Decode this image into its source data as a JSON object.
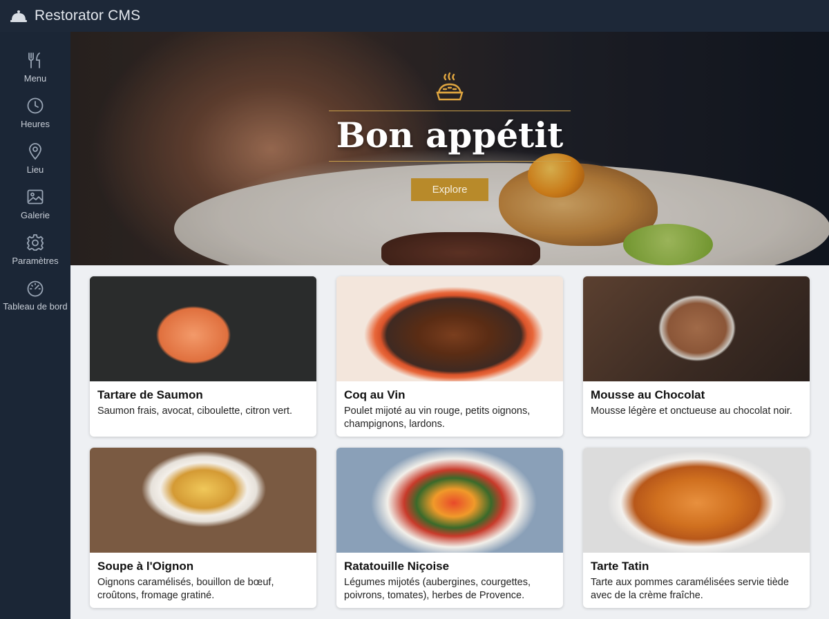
{
  "app": {
    "title": "Restorator CMS",
    "logo_icon": "cloche-icon"
  },
  "sidebar": {
    "items": [
      {
        "label": "Menu",
        "icon": "fork-knife-icon"
      },
      {
        "label": "Heures",
        "icon": "clock-icon"
      },
      {
        "label": "Lieu",
        "icon": "location-pin-icon"
      },
      {
        "label": "Galerie",
        "icon": "image-icon"
      },
      {
        "label": "Paramètres",
        "icon": "gear-icon"
      },
      {
        "label": "Tableau de bord",
        "icon": "gauge-icon"
      }
    ]
  },
  "hero": {
    "title": "Bon appétit",
    "icon": "pie-icon",
    "button_label": "Explore"
  },
  "dishes": [
    {
      "name": "Tartare de Saumon",
      "description": "Saumon frais, avocat, ciboulette, citron vert."
    },
    {
      "name": "Coq au Vin",
      "description": "Poulet mijoté au vin rouge, petits oignons, champignons, lardons."
    },
    {
      "name": "Mousse au Chocolat",
      "description": "Mousse légère et onctueuse au chocolat noir."
    },
    {
      "name": "Soupe à l'Oignon",
      "description": "Oignons caramélisés, bouillon de bœuf, croûtons, fromage gratiné."
    },
    {
      "name": "Ratatouille Niçoise",
      "description": "Légumes mijotés (aubergines, courgettes, poivrons, tomates), herbes de Provence."
    },
    {
      "name": "Tarte Tatin",
      "description": "Tarte aux pommes caramélisées servie tiède avec de la crème fraîche."
    }
  ],
  "colors": {
    "topbar": "#1d2838",
    "sidebar": "#1b2636",
    "accent": "#b88a2a",
    "background": "#eef0f3"
  }
}
